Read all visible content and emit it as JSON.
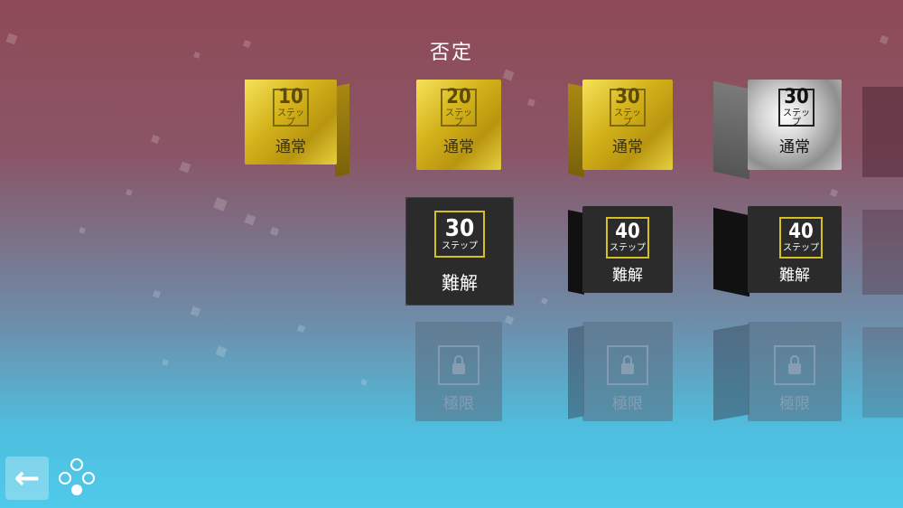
{
  "title": "否定",
  "unit_label": "ステップ",
  "tiers": {
    "normal": "通常",
    "hard": "難解",
    "extreme": "極限"
  },
  "columns": [
    {
      "normal": {
        "steps": "10",
        "style": "gold"
      }
    },
    {
      "normal": {
        "steps": "20",
        "style": "gold"
      },
      "hard": {
        "steps": "30",
        "style": "black"
      },
      "extreme": {
        "locked": true
      }
    },
    {
      "normal": {
        "steps": "30",
        "style": "gold"
      },
      "hard": {
        "steps": "40",
        "style": "black"
      },
      "extreme": {
        "locked": true
      }
    },
    {
      "normal": {
        "steps": "30",
        "style": "silver"
      },
      "hard": {
        "steps": "40",
        "style": "black"
      },
      "extreme": {
        "locked": true
      }
    }
  ],
  "buttons": {
    "back": "←"
  },
  "icons": [
    "arrow-left-icon",
    "network-icon",
    "lock-icon"
  ],
  "colors": {
    "gold": "#d4b21a",
    "silver": "#cfcfcf",
    "black": "#2b2b2b",
    "badge_yellow": "#d4c020"
  }
}
